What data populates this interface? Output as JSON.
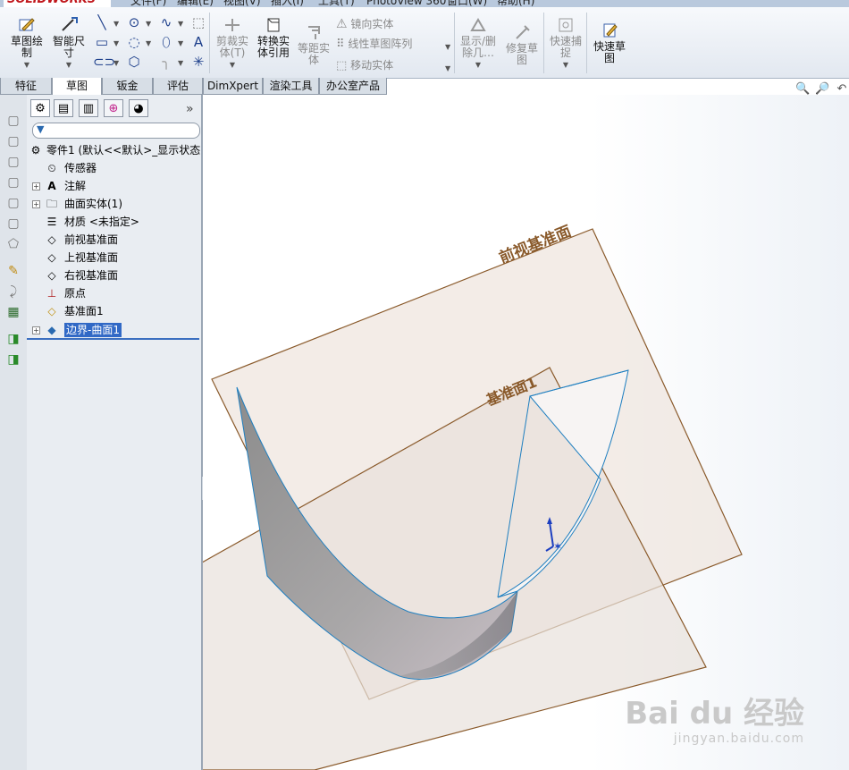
{
  "app": {
    "logo": "SOLIDWORKS",
    "menu": [
      "文件(F)",
      "编辑(E)",
      "视图(V)",
      "插入(I)",
      "工具(T)",
      "PhotoView 360",
      "窗口(W)",
      "帮助(H)"
    ]
  },
  "ribbon": {
    "sketch_label": "草图绘\n制",
    "smart_dim_label": "智能尺\n寸",
    "trim_label": "剪裁实\n体(T)",
    "convert_label": "转换实\n体引用",
    "offset_label": "等距实\n体",
    "mirror_label": "镜向实体",
    "linear_pattern_label": "线性草图阵列",
    "move_label": "移动实体",
    "show_delete_label": "显示/删\n除几…",
    "repair_label": "修复草\n图",
    "quick_snap_label": "快速捕\n捉",
    "rapid_sketch_label": "快速草\n图"
  },
  "tabs": [
    {
      "label": "特征"
    },
    {
      "label": "草图"
    },
    {
      "label": "钣金"
    },
    {
      "label": "评估"
    },
    {
      "label": "DimXpert"
    },
    {
      "label": "渲染工具"
    },
    {
      "label": "办公室产品"
    }
  ],
  "tree": {
    "root": "零件1 (默认<<默认>_显示状态",
    "items": [
      {
        "label": "传感器"
      },
      {
        "label": "注解"
      },
      {
        "label": "曲面实体(1)"
      },
      {
        "label": "材质 <未指定>"
      },
      {
        "label": "前视基准面"
      },
      {
        "label": "上视基准面"
      },
      {
        "label": "右视基准面"
      },
      {
        "label": "原点"
      },
      {
        "label": "基准面1"
      },
      {
        "label": "边界-曲面1"
      }
    ]
  },
  "viewport": {
    "front_plane_label": "前视基准面",
    "plane1_label": "基准面1"
  },
  "watermark": {
    "brand": "Bai du 经验",
    "url": "jingyan.baidu.com"
  },
  "colors": {
    "plane_edge": "#8a5a2b",
    "plane_fill": "#efe6df",
    "surface_edge": "#1f7fc0",
    "selection": "#3169c6"
  }
}
